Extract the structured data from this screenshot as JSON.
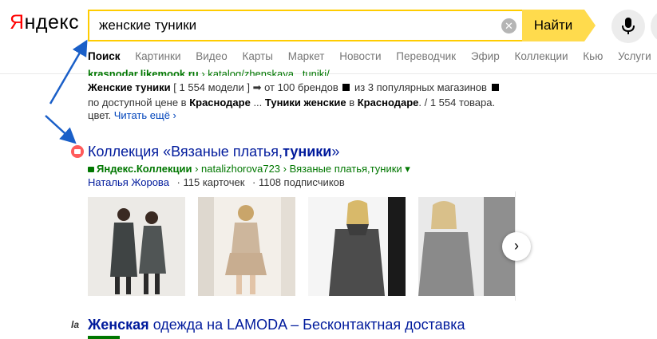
{
  "logo": {
    "first_letter": "Я",
    "rest": "ндекс"
  },
  "search": {
    "query": "женские туники",
    "clear_symbol": "✕",
    "button_label": "Найти"
  },
  "tabs": [
    {
      "label": "Поиск",
      "active": true
    },
    {
      "label": "Картинки"
    },
    {
      "label": "Видео"
    },
    {
      "label": "Карты"
    },
    {
      "label": "Маркет"
    },
    {
      "label": "Новости"
    },
    {
      "label": "Переводчик"
    },
    {
      "label": "Эфир"
    },
    {
      "label": "Коллекции"
    },
    {
      "label": "Кью"
    },
    {
      "label": "Услуги"
    }
  ],
  "result1": {
    "url_domain": "krasnodar.likemook.ru",
    "url_path": "› katalog/zhenskaya...tuniki/",
    "line1_bold": "Женские туники",
    "line1_rest_a": " [ 1 554 модели ] ➡ от 100 брендов ",
    "line1_rest_b": " из 3 популярных магазинов ",
    "line2_a": "по доступной цене в ",
    "line2_b": "Краснодаре",
    "line2_c": " ... ",
    "line2_d": "Туники женские",
    "line2_e": " в ",
    "line2_f": "Краснодаре",
    "line2_g": ". / 1 554 товара.",
    "line3_a": "цвет. ",
    "read_more": "Читать ещё ›"
  },
  "result2": {
    "title_a": "Коллекция «Вязаные платья,",
    "title_b": "туники",
    "title_c": "»",
    "url_site": "Яндекс.Коллекции",
    "url_rest": " › natalizhorova723 › Вязаные платья,туники ▾",
    "author": "Наталья Жорова",
    "cards": "· 115 карточек",
    "subscribers": "· 1108 подписчиков",
    "next_symbol": "›"
  },
  "result3": {
    "favicon_text": "la",
    "title_bold": "Женская",
    "title_rest": " одежда на LAMODA – Бесконтактная доставка"
  },
  "colors": {
    "accent_yellow": "#ffdb4d",
    "link_blue": "#001a9c",
    "url_green": "#007700",
    "annotation_arrow": "#1a5fc8"
  }
}
